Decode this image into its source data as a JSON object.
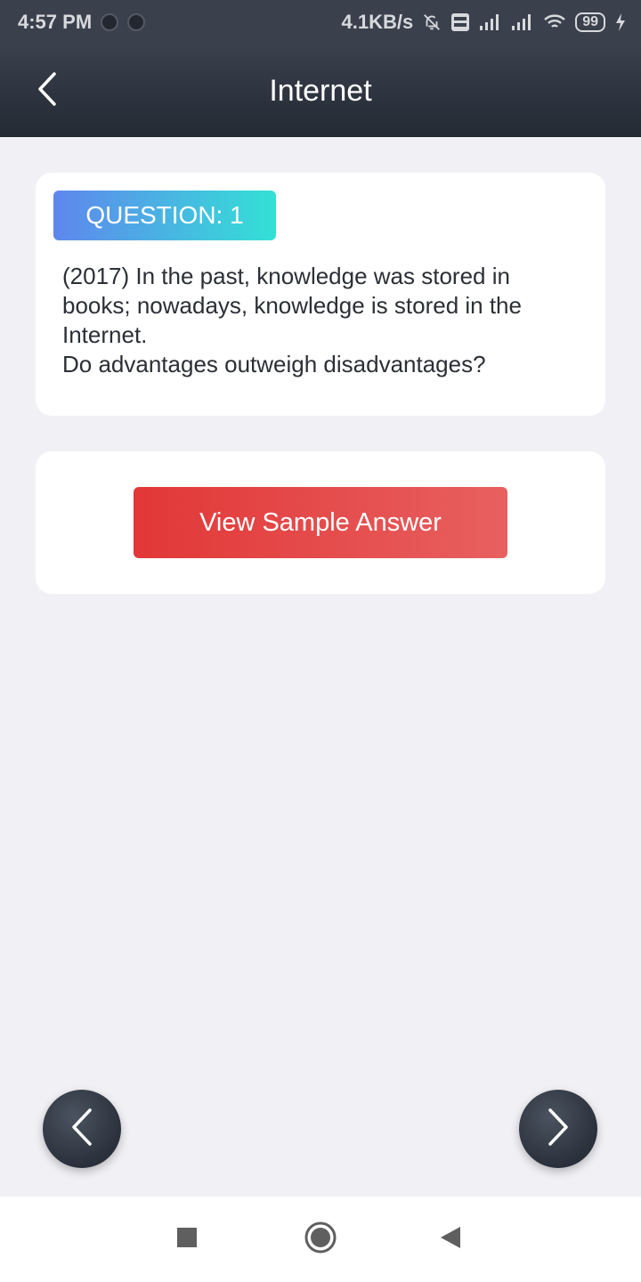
{
  "status_bar": {
    "time": "4:57 PM",
    "network_speed": "4.1KB/s",
    "battery": "99",
    "icons": [
      "dot-icon",
      "dot-icon",
      "bell-off-icon",
      "volte-icon",
      "signal-icon",
      "signal-icon",
      "wifi-icon",
      "battery-icon",
      "charging-icon"
    ]
  },
  "app_bar": {
    "title": "Internet",
    "back_icon": "chevron-left-icon"
  },
  "question": {
    "badge": "QUESTION: 1",
    "text_line1": "(2017) In the past, knowledge was stored in books; nowadays, knowledge is stored in the Internet.",
    "text_line2": "Do advantages outweigh disadvantages?"
  },
  "answer": {
    "button_label": "View Sample Answer"
  },
  "navigation": {
    "prev_icon": "chevron-left-icon",
    "next_icon": "chevron-right-icon"
  },
  "system_nav": {
    "icons": [
      "recents-square-icon",
      "home-circle-icon",
      "back-triangle-icon"
    ]
  },
  "colors": {
    "header_bg": "#2b313c",
    "page_bg": "#f1f1f5",
    "badge_gradient_start": "#5f86ee",
    "badge_gradient_end": "#33e1d6",
    "button_red": "#e23737"
  }
}
